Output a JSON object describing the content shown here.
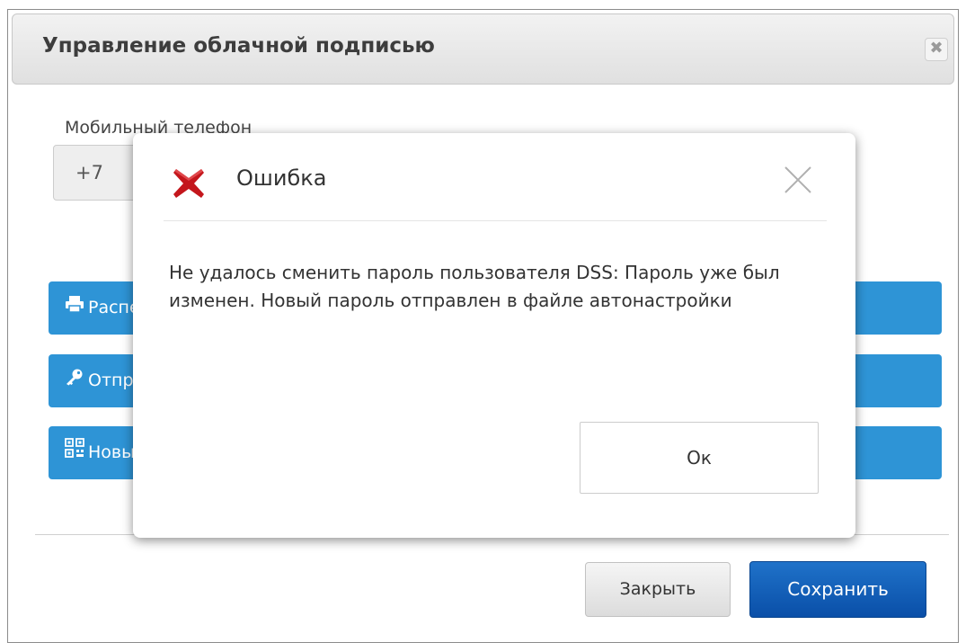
{
  "window": {
    "title": "Управление облачной подписью",
    "close_glyph": "✖"
  },
  "phone": {
    "label": "Мобильный телефон",
    "prefix": "+7"
  },
  "actions": [
    {
      "label": "Распечатать",
      "icon": "printer-icon"
    },
    {
      "label": "Отправить",
      "icon": "key-icon"
    },
    {
      "label": "Новый",
      "icon": "qr-code-icon"
    }
  ],
  "footer": {
    "close_label": "Закрыть",
    "save_label": "Сохранить"
  },
  "dialog": {
    "title": "Ошибка",
    "message": "Не удалось сменить пароль пользователя DSS: Пароль уже был изменен. Новый пароль отправлен в файле автонастройки",
    "ok_label": "Ок",
    "error_icon": "error-x-icon",
    "close_icon": "close-icon"
  },
  "colors": {
    "action_blue": "#2e94d6",
    "save_blue": "#0a4fa8",
    "error_red": "#c4161c"
  }
}
